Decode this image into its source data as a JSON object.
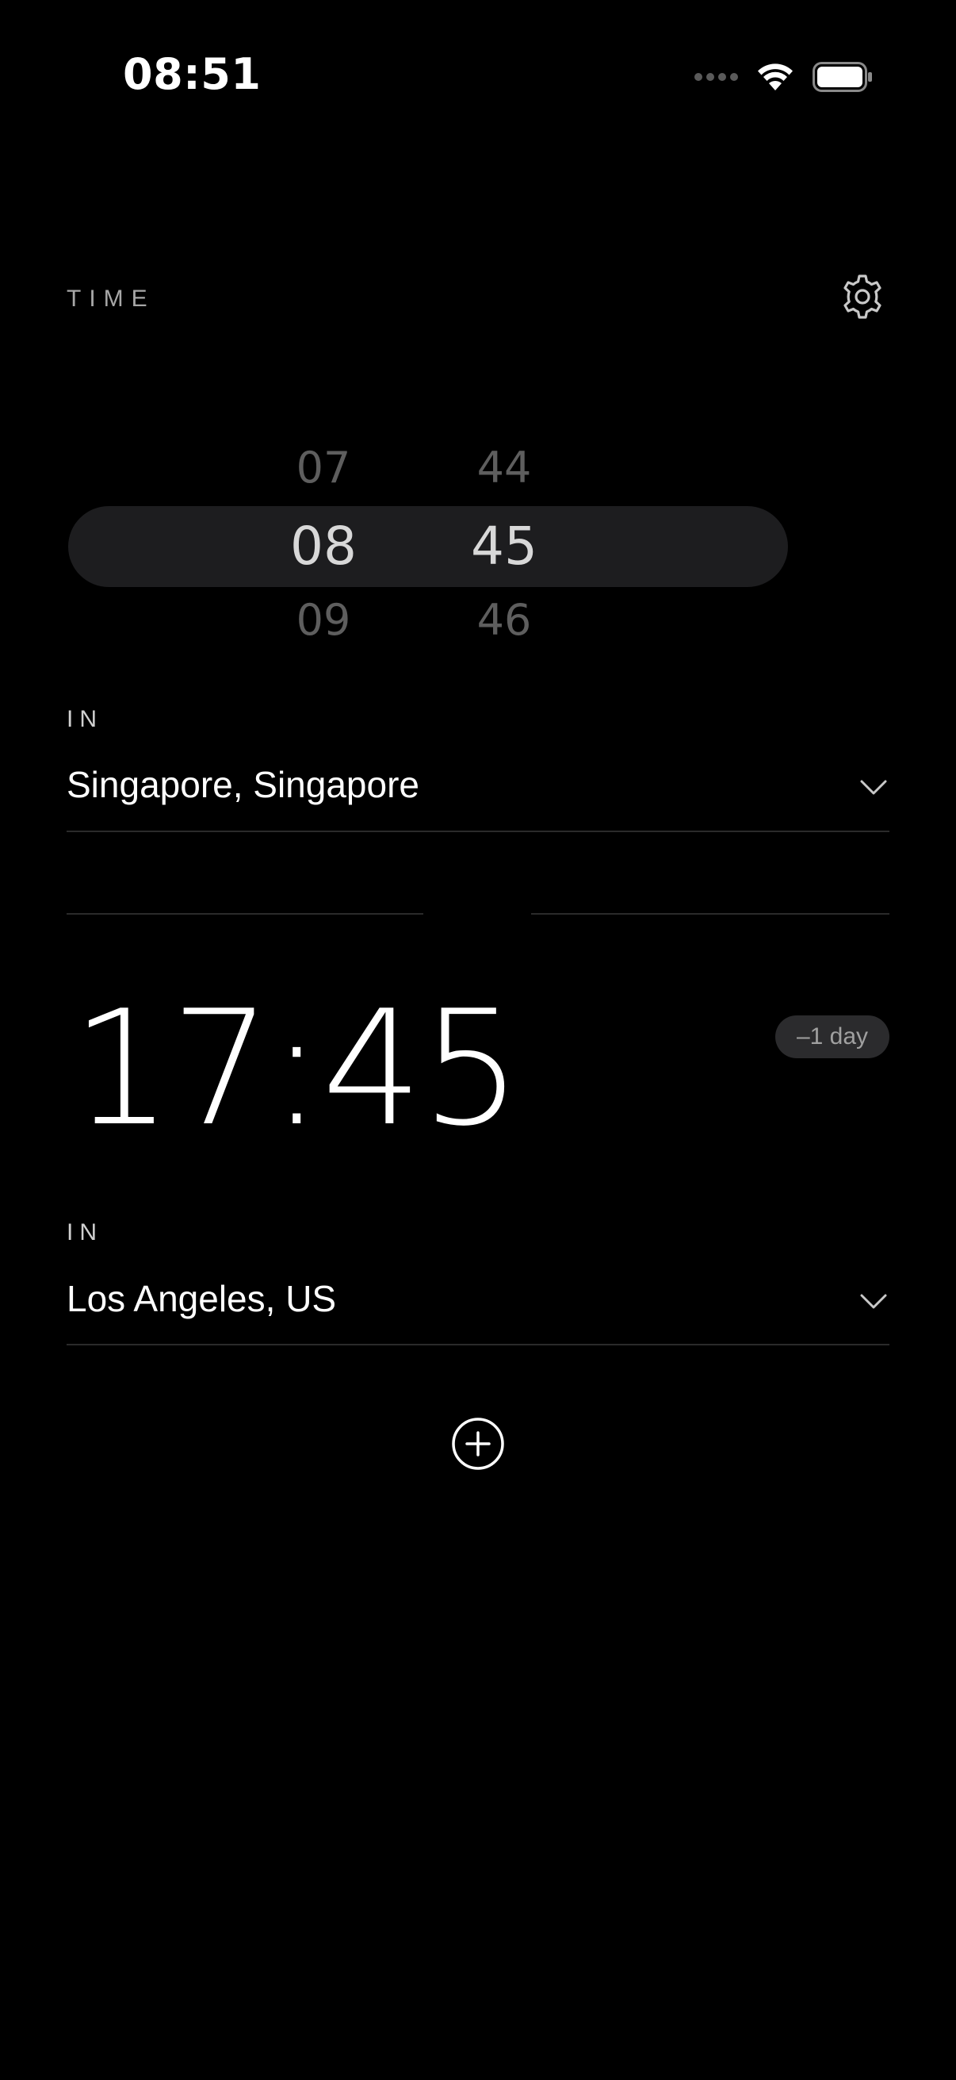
{
  "status_bar": {
    "time": "08:51"
  },
  "header": {
    "title": "TIME"
  },
  "picker": {
    "hours": {
      "prev": "07",
      "current": "08",
      "next": "09"
    },
    "minutes": {
      "prev": "44",
      "current": "45",
      "next": "46"
    }
  },
  "source": {
    "label": "IN",
    "city": "Singapore, Singapore"
  },
  "result": {
    "time": "17:45",
    "day_offset": "–1 day",
    "label": "IN",
    "city": "Los Angeles, US"
  },
  "colors": {
    "background": "#000000",
    "highlight": "#1d1d1f",
    "badge": "#2b2b2d"
  },
  "icons": {
    "settings": "gear-icon",
    "dropdown": "chevron-down-icon",
    "add": "plus-circle-icon"
  }
}
